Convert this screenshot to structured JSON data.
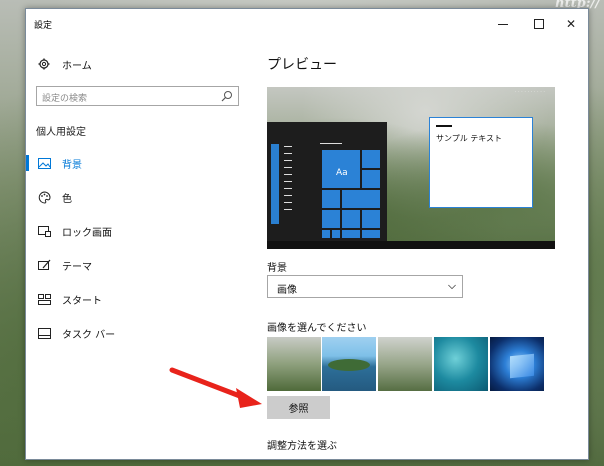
{
  "watermark": "http://",
  "window": {
    "title": "設定",
    "controls": {
      "minimize": "—",
      "maximize": "☐",
      "close": "✕"
    }
  },
  "sidebar": {
    "home": "ホーム",
    "search_placeholder": "設定の検索",
    "section": "個人用設定",
    "items": [
      {
        "label": "背景",
        "icon": "picture-icon",
        "active": true
      },
      {
        "label": "色",
        "icon": "palette-icon"
      },
      {
        "label": "ロック画面",
        "icon": "lock-screen-icon"
      },
      {
        "label": "テーマ",
        "icon": "theme-icon"
      },
      {
        "label": "スタート",
        "icon": "start-icon"
      },
      {
        "label": "タスク バー",
        "icon": "taskbar-icon"
      }
    ]
  },
  "main": {
    "preview_title": "プレビュー",
    "preview": {
      "tile_text": "Aa",
      "sample_text": "サンプル テキスト"
    },
    "background_label": "背景",
    "background_value": "画像",
    "choose_label": "画像を選んでください",
    "browse_button": "参照",
    "adjust_label": "調整方法を選ぶ"
  },
  "colors": {
    "accent": "#0078d7",
    "tile": "#2b82d6",
    "arrow": "#e8231b"
  }
}
